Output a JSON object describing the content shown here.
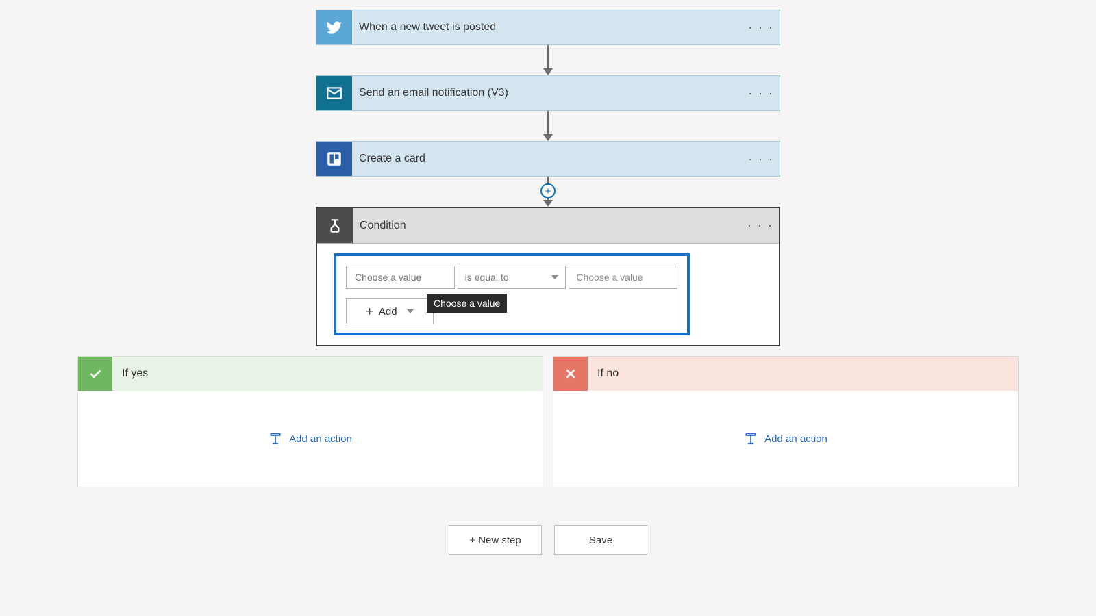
{
  "steps": [
    {
      "title": "When a new tweet is posted"
    },
    {
      "title": "Send an email notification (V3)"
    },
    {
      "title": "Create a card"
    }
  ],
  "condition": {
    "title": "Condition",
    "value1_placeholder": "Choose a value",
    "operator": "is equal to",
    "value2_placeholder": "Choose a value",
    "add_label": "Add",
    "tooltip": "Choose a value"
  },
  "branches": {
    "yes": {
      "title": "If yes",
      "add_action_label": "Add an action"
    },
    "no": {
      "title": "If no",
      "add_action_label": "Add an action"
    }
  },
  "footer": {
    "new_step": "+ New step",
    "save": "Save"
  },
  "ellipsis_glyph": "· · ·",
  "plus_glyph": "+"
}
